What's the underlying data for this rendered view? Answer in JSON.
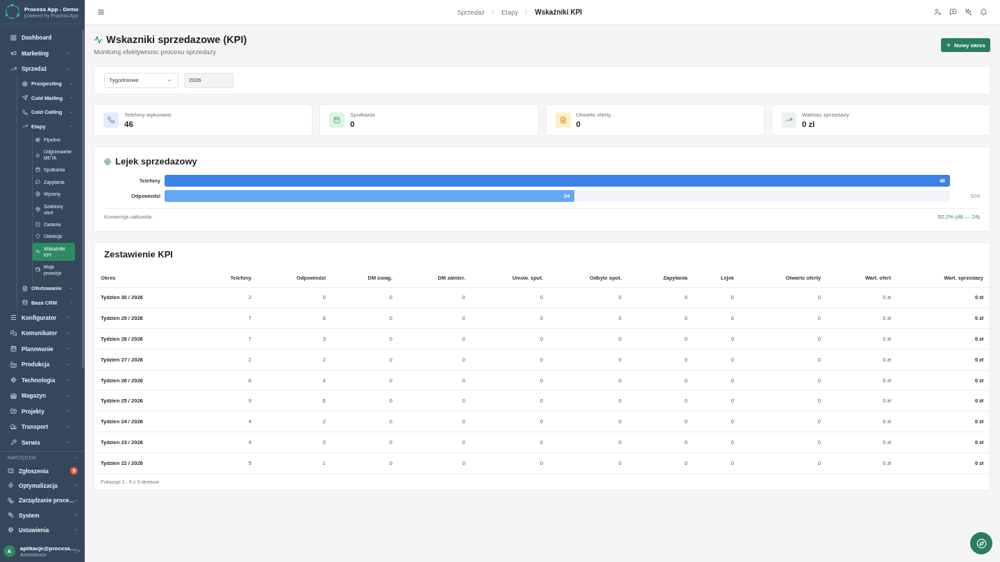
{
  "sidebar": {
    "app_name": "Process App - Demo",
    "app_tagline": "powered by Process App",
    "items": [
      {
        "label": "Dashboard",
        "kind": "link",
        "selected": false
      },
      {
        "label": "Marketing",
        "kind": "group",
        "expanded": false,
        "selected": false
      },
      {
        "label": "Sprzedaż",
        "kind": "group",
        "expanded": true,
        "selected": false,
        "children": [
          {
            "label": "Prospecting",
            "kind": "group",
            "expanded": false,
            "selected": false
          },
          {
            "label": "Cold Mailing",
            "kind": "group",
            "expanded": false,
            "selected": false
          },
          {
            "label": "Cold Calling",
            "kind": "group",
            "expanded": false,
            "selected": false
          },
          {
            "label": "Etapy",
            "kind": "group",
            "expanded": true,
            "selected": false,
            "children": [
              {
                "label": "Pipeline",
                "selected": false
              },
              {
                "label": "Odgrzewanie META",
                "selected": false
              },
              {
                "label": "Spotkania",
                "selected": false
              },
              {
                "label": "Zapytania",
                "selected": false
              },
              {
                "label": "Wyceny",
                "selected": false
              },
              {
                "label": "Szablony ofert",
                "selected": false
              },
              {
                "label": "Zadania",
                "selected": false
              },
              {
                "label": "Obiekcje",
                "selected": false
              },
              {
                "label": "Wskaźniki KPI",
                "selected": true
              },
              {
                "label": "Moja prowizja",
                "selected": false
              }
            ]
          },
          {
            "label": "Ofertowanie",
            "kind": "group",
            "expanded": false,
            "selected": false
          },
          {
            "label": "Baza CRM",
            "kind": "group",
            "expanded": false,
            "selected": false
          }
        ]
      },
      {
        "label": "Konfigurator",
        "kind": "group",
        "expanded": false,
        "selected": false
      },
      {
        "label": "Komunikator",
        "kind": "group",
        "expanded": false,
        "selected": false
      },
      {
        "label": "Planowanie",
        "kind": "group",
        "expanded": false,
        "selected": false
      },
      {
        "label": "Produkcja",
        "kind": "group",
        "expanded": false,
        "selected": false
      },
      {
        "label": "Technologia",
        "kind": "group",
        "expanded": false,
        "selected": false
      },
      {
        "label": "Magazyn",
        "kind": "group",
        "expanded": false,
        "selected": false
      },
      {
        "label": "Projekty",
        "kind": "group",
        "expanded": false,
        "selected": false
      },
      {
        "label": "Transport",
        "kind": "group",
        "expanded": false,
        "selected": false
      },
      {
        "label": "Serwis",
        "kind": "group",
        "expanded": false,
        "selected": false
      }
    ],
    "tools": {
      "title": "NARZĘDZIA",
      "items": [
        {
          "label": "Zgłoszenia",
          "kind": "link",
          "selected": false,
          "badge": "5"
        },
        {
          "label": "Optymalizacja",
          "kind": "group",
          "expanded": false,
          "selected": false
        },
        {
          "label": "Zarządzanie proce...",
          "kind": "group",
          "expanded": false,
          "selected": false
        },
        {
          "label": "System",
          "kind": "group",
          "expanded": false,
          "selected": false
        },
        {
          "label": "Ustawienia",
          "kind": "group",
          "expanded": false,
          "selected": false
        }
      ]
    },
    "user": {
      "initial": "A",
      "name": "aplikacje@process...",
      "role": "Administrator"
    }
  },
  "header": {
    "breadcrumbs": [
      {
        "label": "Sprzedaż",
        "current": false
      },
      {
        "label": "Etapy",
        "current": false
      },
      {
        "label": "Wskaźniki KPI",
        "current": true
      }
    ]
  },
  "page": {
    "title": "Wskazniki sprzedazowe (KPI)",
    "subtitle": "Monitoruj efektywnosc procesu sprzedazy",
    "new_button": "Nowy okres"
  },
  "filters": {
    "period": {
      "value": "Tygodniowe"
    },
    "year": {
      "value": "2026"
    }
  },
  "kpi_cards": [
    {
      "label": "Telefony wykonane",
      "value": "46"
    },
    {
      "label": "Spotkania",
      "value": "0"
    },
    {
      "label": "Otwarte oferty",
      "value": "0"
    },
    {
      "label": "Wartosc sprzedazy",
      "value": "0 zl"
    }
  ],
  "funnel": {
    "title": "Lejek sprzedazowy",
    "stages": [
      {
        "label": "Telefony",
        "value": "46",
        "level": 1,
        "color": "#3b82e6"
      },
      {
        "label": "Odpowiedzi",
        "value": "24",
        "level": 0.522,
        "percent": "52%",
        "color": "#62a8f3"
      }
    ],
    "conversion_label": "Konwersja całkowita:",
    "conversion_value": "52.2% (46 — 24)"
  },
  "kpi_table": {
    "title": "Zestawienie KPI",
    "columns": [
      "Okres",
      "Telefony",
      "Odpowiedzi",
      "DM osiag.",
      "DM zainter.",
      "Umow. spot.",
      "Odbyte spot.",
      "Zapytania",
      "Lejek",
      "Otwarte oferty",
      "Wart. ofert",
      "Wart. sprzedazy"
    ],
    "rows": [
      [
        "Tydzien 30 / 2026",
        "2",
        "0",
        "0",
        "0",
        "0",
        "0",
        "0",
        "0",
        "0",
        "0 zł",
        "0 zł"
      ],
      [
        "Tydzien 29 / 2026",
        "7",
        "6",
        "0",
        "0",
        "0",
        "0",
        "0",
        "0",
        "0",
        "0 zł",
        "0 zł"
      ],
      [
        "Tydzien 28 / 2026",
        "7",
        "3",
        "0",
        "0",
        "0",
        "0",
        "0",
        "0",
        "0",
        "0 zł",
        "0 zł"
      ],
      [
        "Tydzien 27 / 2026",
        "2",
        "2",
        "0",
        "0",
        "0",
        "0",
        "0",
        "0",
        "0",
        "0 zł",
        "0 zł"
      ],
      [
        "Tydzien 26 / 2026",
        "6",
        "4",
        "0",
        "0",
        "0",
        "0",
        "0",
        "0",
        "0",
        "0 zł",
        "0 zł"
      ],
      [
        "Tydzien 25 / 2026",
        "9",
        "6",
        "0",
        "0",
        "0",
        "0",
        "0",
        "0",
        "0",
        "0 zł",
        "0 zł"
      ],
      [
        "Tydzien 24 / 2026",
        "4",
        "2",
        "0",
        "0",
        "0",
        "0",
        "0",
        "0",
        "0",
        "0 zł",
        "0 zł"
      ],
      [
        "Tydzien 23 / 2026",
        "4",
        "0",
        "0",
        "0",
        "0",
        "0",
        "0",
        "0",
        "0",
        "0 zł",
        "0 zł"
      ],
      [
        "Tydzien 22 / 2026",
        "5",
        "1",
        "0",
        "0",
        "0",
        "0",
        "0",
        "0",
        "0",
        "0 zł",
        "0 zł"
      ]
    ],
    "footer": "Pokazuje 1 - 9 z 9 okresow"
  }
}
